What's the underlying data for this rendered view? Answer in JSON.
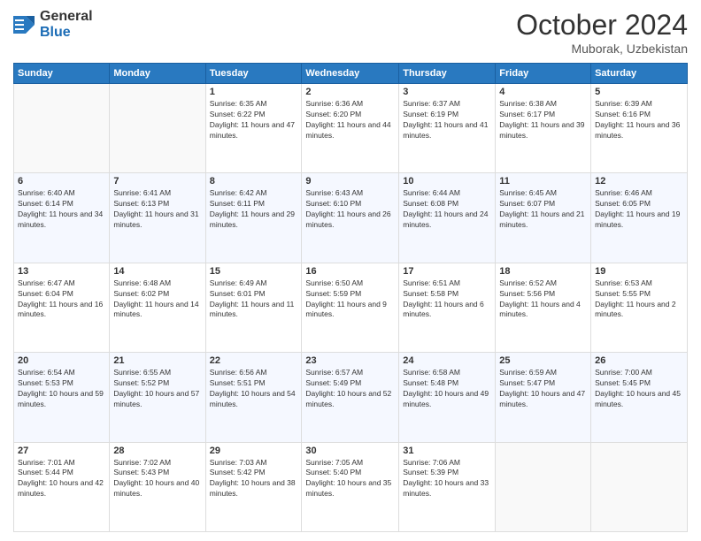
{
  "header": {
    "logo_general": "General",
    "logo_blue": "Blue",
    "month_title": "October 2024",
    "location": "Muborak, Uzbekistan"
  },
  "weekdays": [
    "Sunday",
    "Monday",
    "Tuesday",
    "Wednesday",
    "Thursday",
    "Friday",
    "Saturday"
  ],
  "weeks": [
    [
      {
        "day": "",
        "sunrise": "",
        "sunset": "",
        "daylight": ""
      },
      {
        "day": "",
        "sunrise": "",
        "sunset": "",
        "daylight": ""
      },
      {
        "day": "1",
        "sunrise": "Sunrise: 6:35 AM",
        "sunset": "Sunset: 6:22 PM",
        "daylight": "Daylight: 11 hours and 47 minutes."
      },
      {
        "day": "2",
        "sunrise": "Sunrise: 6:36 AM",
        "sunset": "Sunset: 6:20 PM",
        "daylight": "Daylight: 11 hours and 44 minutes."
      },
      {
        "day": "3",
        "sunrise": "Sunrise: 6:37 AM",
        "sunset": "Sunset: 6:19 PM",
        "daylight": "Daylight: 11 hours and 41 minutes."
      },
      {
        "day": "4",
        "sunrise": "Sunrise: 6:38 AM",
        "sunset": "Sunset: 6:17 PM",
        "daylight": "Daylight: 11 hours and 39 minutes."
      },
      {
        "day": "5",
        "sunrise": "Sunrise: 6:39 AM",
        "sunset": "Sunset: 6:16 PM",
        "daylight": "Daylight: 11 hours and 36 minutes."
      }
    ],
    [
      {
        "day": "6",
        "sunrise": "Sunrise: 6:40 AM",
        "sunset": "Sunset: 6:14 PM",
        "daylight": "Daylight: 11 hours and 34 minutes."
      },
      {
        "day": "7",
        "sunrise": "Sunrise: 6:41 AM",
        "sunset": "Sunset: 6:13 PM",
        "daylight": "Daylight: 11 hours and 31 minutes."
      },
      {
        "day": "8",
        "sunrise": "Sunrise: 6:42 AM",
        "sunset": "Sunset: 6:11 PM",
        "daylight": "Daylight: 11 hours and 29 minutes."
      },
      {
        "day": "9",
        "sunrise": "Sunrise: 6:43 AM",
        "sunset": "Sunset: 6:10 PM",
        "daylight": "Daylight: 11 hours and 26 minutes."
      },
      {
        "day": "10",
        "sunrise": "Sunrise: 6:44 AM",
        "sunset": "Sunset: 6:08 PM",
        "daylight": "Daylight: 11 hours and 24 minutes."
      },
      {
        "day": "11",
        "sunrise": "Sunrise: 6:45 AM",
        "sunset": "Sunset: 6:07 PM",
        "daylight": "Daylight: 11 hours and 21 minutes."
      },
      {
        "day": "12",
        "sunrise": "Sunrise: 6:46 AM",
        "sunset": "Sunset: 6:05 PM",
        "daylight": "Daylight: 11 hours and 19 minutes."
      }
    ],
    [
      {
        "day": "13",
        "sunrise": "Sunrise: 6:47 AM",
        "sunset": "Sunset: 6:04 PM",
        "daylight": "Daylight: 11 hours and 16 minutes."
      },
      {
        "day": "14",
        "sunrise": "Sunrise: 6:48 AM",
        "sunset": "Sunset: 6:02 PM",
        "daylight": "Daylight: 11 hours and 14 minutes."
      },
      {
        "day": "15",
        "sunrise": "Sunrise: 6:49 AM",
        "sunset": "Sunset: 6:01 PM",
        "daylight": "Daylight: 11 hours and 11 minutes."
      },
      {
        "day": "16",
        "sunrise": "Sunrise: 6:50 AM",
        "sunset": "Sunset: 5:59 PM",
        "daylight": "Daylight: 11 hours and 9 minutes."
      },
      {
        "day": "17",
        "sunrise": "Sunrise: 6:51 AM",
        "sunset": "Sunset: 5:58 PM",
        "daylight": "Daylight: 11 hours and 6 minutes."
      },
      {
        "day": "18",
        "sunrise": "Sunrise: 6:52 AM",
        "sunset": "Sunset: 5:56 PM",
        "daylight": "Daylight: 11 hours and 4 minutes."
      },
      {
        "day": "19",
        "sunrise": "Sunrise: 6:53 AM",
        "sunset": "Sunset: 5:55 PM",
        "daylight": "Daylight: 11 hours and 2 minutes."
      }
    ],
    [
      {
        "day": "20",
        "sunrise": "Sunrise: 6:54 AM",
        "sunset": "Sunset: 5:53 PM",
        "daylight": "Daylight: 10 hours and 59 minutes."
      },
      {
        "day": "21",
        "sunrise": "Sunrise: 6:55 AM",
        "sunset": "Sunset: 5:52 PM",
        "daylight": "Daylight: 10 hours and 57 minutes."
      },
      {
        "day": "22",
        "sunrise": "Sunrise: 6:56 AM",
        "sunset": "Sunset: 5:51 PM",
        "daylight": "Daylight: 10 hours and 54 minutes."
      },
      {
        "day": "23",
        "sunrise": "Sunrise: 6:57 AM",
        "sunset": "Sunset: 5:49 PM",
        "daylight": "Daylight: 10 hours and 52 minutes."
      },
      {
        "day": "24",
        "sunrise": "Sunrise: 6:58 AM",
        "sunset": "Sunset: 5:48 PM",
        "daylight": "Daylight: 10 hours and 49 minutes."
      },
      {
        "day": "25",
        "sunrise": "Sunrise: 6:59 AM",
        "sunset": "Sunset: 5:47 PM",
        "daylight": "Daylight: 10 hours and 47 minutes."
      },
      {
        "day": "26",
        "sunrise": "Sunrise: 7:00 AM",
        "sunset": "Sunset: 5:45 PM",
        "daylight": "Daylight: 10 hours and 45 minutes."
      }
    ],
    [
      {
        "day": "27",
        "sunrise": "Sunrise: 7:01 AM",
        "sunset": "Sunset: 5:44 PM",
        "daylight": "Daylight: 10 hours and 42 minutes."
      },
      {
        "day": "28",
        "sunrise": "Sunrise: 7:02 AM",
        "sunset": "Sunset: 5:43 PM",
        "daylight": "Daylight: 10 hours and 40 minutes."
      },
      {
        "day": "29",
        "sunrise": "Sunrise: 7:03 AM",
        "sunset": "Sunset: 5:42 PM",
        "daylight": "Daylight: 10 hours and 38 minutes."
      },
      {
        "day": "30",
        "sunrise": "Sunrise: 7:05 AM",
        "sunset": "Sunset: 5:40 PM",
        "daylight": "Daylight: 10 hours and 35 minutes."
      },
      {
        "day": "31",
        "sunrise": "Sunrise: 7:06 AM",
        "sunset": "Sunset: 5:39 PM",
        "daylight": "Daylight: 10 hours and 33 minutes."
      },
      {
        "day": "",
        "sunrise": "",
        "sunset": "",
        "daylight": ""
      },
      {
        "day": "",
        "sunrise": "",
        "sunset": "",
        "daylight": ""
      }
    ]
  ]
}
